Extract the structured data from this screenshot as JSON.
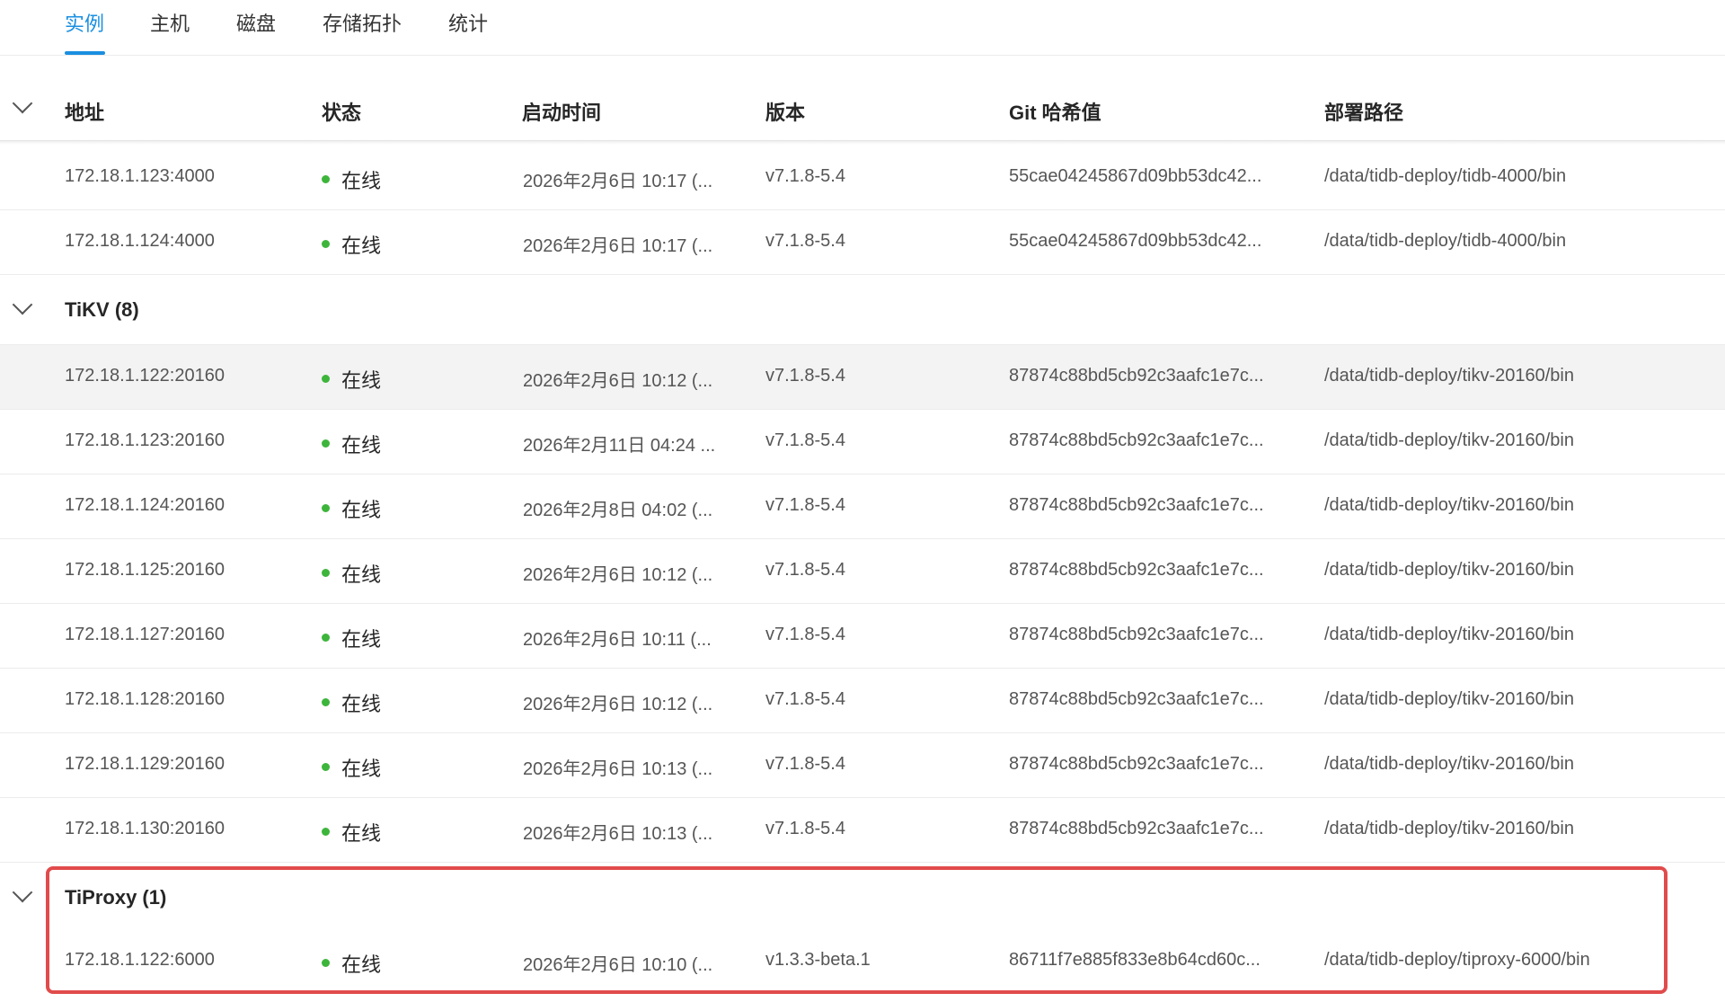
{
  "tabs": [
    {
      "label": "实例",
      "active": true
    },
    {
      "label": "主机",
      "active": false
    },
    {
      "label": "磁盘",
      "active": false
    },
    {
      "label": "存储拓扑",
      "active": false
    },
    {
      "label": "统计",
      "active": false
    }
  ],
  "columns": {
    "address": "地址",
    "status": "状态",
    "start_time": "启动时间",
    "version": "版本",
    "git_hash": "Git 哈希值",
    "deploy_path": "部署路径"
  },
  "tidb_rows": [
    {
      "address": "172.18.1.123:4000",
      "status": "在线",
      "start_time": "2026年2月6日 10:17 (...",
      "version": "v7.1.8-5.4",
      "git_hash": "55cae04245867d09bb53dc42...",
      "deploy_path": "/data/tidb-deploy/tidb-4000/bin"
    },
    {
      "address": "172.18.1.124:4000",
      "status": "在线",
      "start_time": "2026年2月6日 10:17 (...",
      "version": "v7.1.8-5.4",
      "git_hash": "55cae04245867d09bb53dc42...",
      "deploy_path": "/data/tidb-deploy/tidb-4000/bin"
    }
  ],
  "tikv_group": {
    "label": "TiKV (8)"
  },
  "tikv_rows": [
    {
      "address": "172.18.1.122:20160",
      "status": "在线",
      "start_time": "2026年2月6日 10:12 (...",
      "version": "v7.1.8-5.4",
      "git_hash": "87874c88bd5cb92c3aafc1e7c...",
      "deploy_path": "/data/tidb-deploy/tikv-20160/bin"
    },
    {
      "address": "172.18.1.123:20160",
      "status": "在线",
      "start_time": "2026年2月11日 04:24 ...",
      "version": "v7.1.8-5.4",
      "git_hash": "87874c88bd5cb92c3aafc1e7c...",
      "deploy_path": "/data/tidb-deploy/tikv-20160/bin"
    },
    {
      "address": "172.18.1.124:20160",
      "status": "在线",
      "start_time": "2026年2月8日 04:02 (...",
      "version": "v7.1.8-5.4",
      "git_hash": "87874c88bd5cb92c3aafc1e7c...",
      "deploy_path": "/data/tidb-deploy/tikv-20160/bin"
    },
    {
      "address": "172.18.1.125:20160",
      "status": "在线",
      "start_time": "2026年2月6日 10:12 (...",
      "version": "v7.1.8-5.4",
      "git_hash": "87874c88bd5cb92c3aafc1e7c...",
      "deploy_path": "/data/tidb-deploy/tikv-20160/bin"
    },
    {
      "address": "172.18.1.127:20160",
      "status": "在线",
      "start_time": "2026年2月6日 10:11 (...",
      "version": "v7.1.8-5.4",
      "git_hash": "87874c88bd5cb92c3aafc1e7c...",
      "deploy_path": "/data/tidb-deploy/tikv-20160/bin"
    },
    {
      "address": "172.18.1.128:20160",
      "status": "在线",
      "start_time": "2026年2月6日 10:12 (...",
      "version": "v7.1.8-5.4",
      "git_hash": "87874c88bd5cb92c3aafc1e7c...",
      "deploy_path": "/data/tidb-deploy/tikv-20160/bin"
    },
    {
      "address": "172.18.1.129:20160",
      "status": "在线",
      "start_time": "2026年2月6日 10:13 (...",
      "version": "v7.1.8-5.4",
      "git_hash": "87874c88bd5cb92c3aafc1e7c...",
      "deploy_path": "/data/tidb-deploy/tikv-20160/bin"
    },
    {
      "address": "172.18.1.130:20160",
      "status": "在线",
      "start_time": "2026年2月6日 10:13 (...",
      "version": "v7.1.8-5.4",
      "git_hash": "87874c88bd5cb92c3aafc1e7c...",
      "deploy_path": "/data/tidb-deploy/tikv-20160/bin"
    }
  ],
  "tiproxy_group": {
    "label": "TiProxy (1)"
  },
  "tiproxy_rows": [
    {
      "address": "172.18.1.122:6000",
      "status": "在线",
      "start_time": "2026年2月6日 10:10 (...",
      "version": "v1.3.3-beta.1",
      "git_hash": "86711f7e885f833e8b64cd60c...",
      "deploy_path": "/data/tidb-deploy/tiproxy-6000/bin"
    }
  ],
  "icons": {
    "collapse": "chevron-down-icon",
    "status": "status-dot-icon"
  },
  "colors": {
    "accent": "#1a8fe0",
    "online": "#3db53b",
    "highlight_border": "#e14b4b",
    "hover_row": "#f3f3f3"
  }
}
